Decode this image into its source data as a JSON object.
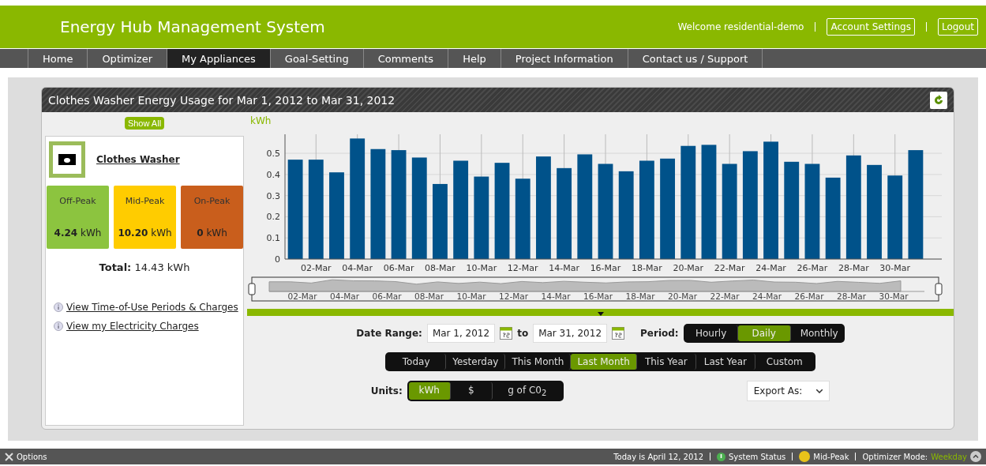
{
  "header": {
    "title": "Energy Hub Management System",
    "welcome": "Welcome residential-demo",
    "links": [
      "Account Settings",
      "Logout"
    ]
  },
  "nav": [
    {
      "label": "Home",
      "selected": false
    },
    {
      "label": "Optimizer",
      "selected": false
    },
    {
      "label": "My Appliances",
      "selected": true
    },
    {
      "label": "Goal-Setting",
      "selected": false
    },
    {
      "label": "Comments",
      "selected": false
    },
    {
      "label": "Help",
      "selected": false
    },
    {
      "label": "Project Information",
      "selected": false
    },
    {
      "label": "Contact us / Support",
      "selected": false
    }
  ],
  "widget": {
    "title": "Clothes Washer Energy Usage for Mar 1, 2012 to Mar 31, 2012"
  },
  "sidebar": {
    "show_all": "Show All",
    "appliance": "Clothes Washer",
    "tariffs": [
      {
        "label": "Off-Peak",
        "value": "4.24",
        "unit": "kWh",
        "color": "#8cc43f"
      },
      {
        "label": "Mid-Peak",
        "value": "10.20",
        "unit": "kWh",
        "color": "#ffcc00"
      },
      {
        "label": "On-Peak",
        "value": "0",
        "unit": "kWh",
        "color": "#c95e1c"
      }
    ],
    "total_label": "Total:",
    "total_value": "14.43",
    "total_unit": "kWh",
    "links": [
      "View Time-of-Use Periods & Charges",
      "View my Electricity Charges"
    ]
  },
  "chart_data": {
    "type": "bar",
    "ylabel": "kWh",
    "categories": [
      null,
      "02-Mar",
      null,
      "04-Mar",
      null,
      "06-Mar",
      null,
      "08-Mar",
      null,
      "10-Mar",
      null,
      "12-Mar",
      null,
      "14-Mar",
      null,
      "16-Mar",
      null,
      "18-Mar",
      null,
      "20-Mar",
      null,
      "22-Mar",
      null,
      "24-Mar",
      null,
      "26-Mar",
      null,
      "28-Mar",
      null,
      "30-Mar",
      null
    ],
    "series": [
      {
        "color": "#00528a",
        "values": [
          0.47,
          0.47,
          0.41,
          0.57,
          0.52,
          0.515,
          0.48,
          0.355,
          0.465,
          0.39,
          0.455,
          0.38,
          0.485,
          0.43,
          0.495,
          0.45,
          0.415,
          0.465,
          0.475,
          0.535,
          0.54,
          0.45,
          0.51,
          0.555,
          0.46,
          0.45,
          0.385,
          0.49,
          0.445,
          0.395,
          0.515
        ]
      }
    ],
    "ylim": [
      0,
      0.59
    ],
    "grid": true,
    "yticks": [
      0,
      0.1,
      0.2,
      0.3,
      0.4,
      0.5
    ]
  },
  "navigator": {
    "labels": [
      "02-Mar",
      "04-Mar",
      "06-Mar",
      "08-Mar",
      "10-Mar",
      "12-Mar",
      "14-Mar",
      "16-Mar",
      "18-Mar",
      "20-Mar",
      "22-Mar",
      "24-Mar",
      "26-Mar",
      "28-Mar",
      "30-Mar"
    ]
  },
  "controls": {
    "date_range_label": "Date Range:",
    "from": "Mar 1, 2012",
    "to_label": "to",
    "to": "Mar 31, 2012",
    "period_label": "Period:",
    "periods": [
      {
        "label": "Hourly",
        "selected": false
      },
      {
        "label": "Daily",
        "selected": true
      },
      {
        "label": "Monthly",
        "selected": false
      }
    ],
    "presets": [
      {
        "label": "Today",
        "selected": false
      },
      {
        "label": "Yesterday",
        "selected": false
      },
      {
        "label": "This Month",
        "selected": false
      },
      {
        "label": "Last Month",
        "selected": true
      },
      {
        "label": "This Year",
        "selected": false
      },
      {
        "label": "Last Year",
        "selected": false
      },
      {
        "label": "Custom",
        "selected": false
      }
    ],
    "units_label": "Units:",
    "units": [
      {
        "label": "kWh",
        "selected": true
      },
      {
        "label": "$",
        "selected": false
      },
      {
        "label": "g of C0$_{2}$",
        "selected": false
      }
    ],
    "export": "Export As:"
  },
  "status_bar": {
    "options": "Options",
    "date": "Today is April 12, 2012",
    "system_status": "System Status",
    "peak": "Mid-Peak",
    "mode_label": "Optimizer Mode:",
    "mode": "Weekday"
  }
}
